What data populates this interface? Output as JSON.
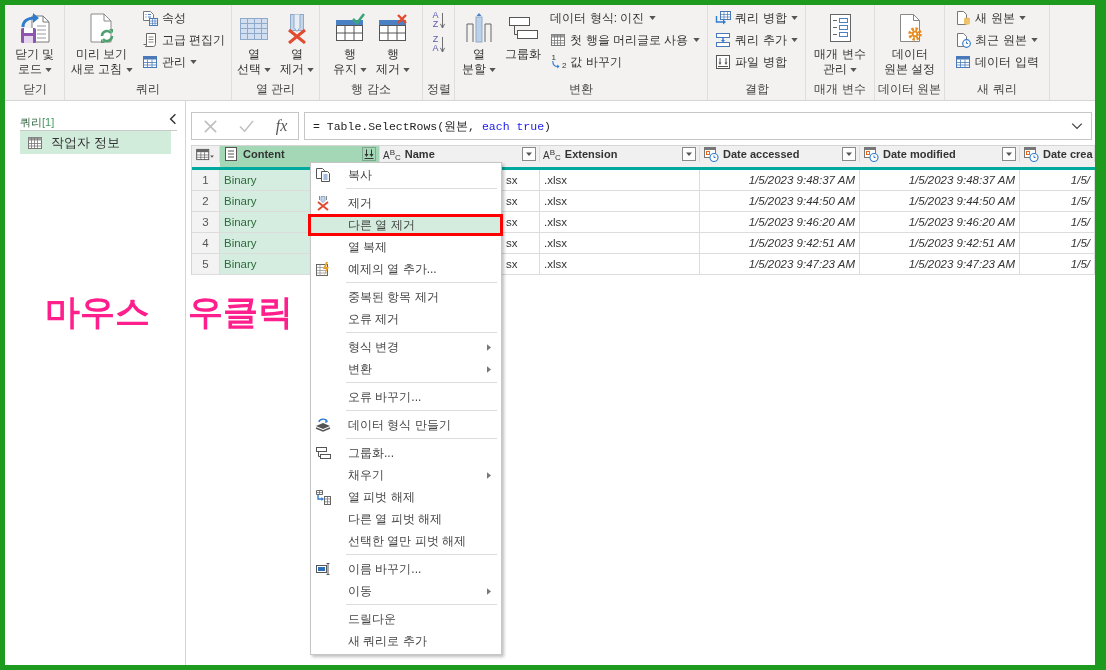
{
  "ribbon": {
    "groups": [
      {
        "label": "닫기",
        "items": [
          {
            "kind": "large",
            "lines": [
              "닫기 및",
              "로드"
            ],
            "dropdown": true
          }
        ]
      },
      {
        "label": "쿼리",
        "items": [
          {
            "kind": "large",
            "lines": [
              "미리 보기",
              "새로 고침"
            ],
            "dropdown": true
          },
          {
            "kind": "small",
            "label": "속성",
            "dropdown": false
          },
          {
            "kind": "small",
            "label": "고급 편집기",
            "dropdown": false
          },
          {
            "kind": "small",
            "label": "관리",
            "dropdown": true
          }
        ]
      },
      {
        "label": "열 관리",
        "items": [
          {
            "kind": "large",
            "lines": [
              "열",
              "선택"
            ],
            "dropdown": true
          },
          {
            "kind": "large",
            "lines": [
              "열",
              "제거"
            ],
            "dropdown": true
          }
        ]
      },
      {
        "label": "행 감소",
        "items": [
          {
            "kind": "large",
            "lines": [
              "행",
              "유지"
            ],
            "dropdown": true
          },
          {
            "kind": "large",
            "lines": [
              "행",
              "제거"
            ],
            "dropdown": true
          }
        ]
      },
      {
        "label": "정렬",
        "items": [
          {
            "kind": "sort",
            "glyphs": [
              "A",
              "Z"
            ]
          },
          {
            "kind": "sort",
            "glyphs": [
              "Z",
              "A"
            ]
          }
        ]
      },
      {
        "label": "변환",
        "items": [
          {
            "kind": "large",
            "lines": [
              "열",
              "분할"
            ],
            "dropdown": true
          },
          {
            "kind": "large",
            "lines": [
              "그룹화"
            ],
            "dropdown": false
          },
          {
            "kind": "small",
            "label": "데이터 형식: 이진",
            "dropdown": true
          },
          {
            "kind": "small",
            "label": "첫 행을 머리글로 사용",
            "dropdown": true
          },
          {
            "kind": "small",
            "label": "값 바꾸기",
            "dropdown": false,
            "glyphs": [
              "1",
              "2"
            ]
          }
        ]
      },
      {
        "label": "결합",
        "items": [
          {
            "kind": "small",
            "label": "쿼리 병합",
            "dropdown": true
          },
          {
            "kind": "small",
            "label": "쿼리 추가",
            "dropdown": true
          },
          {
            "kind": "small",
            "label": "파일 병합",
            "dropdown": false
          }
        ]
      },
      {
        "label": "매개 변수",
        "items": [
          {
            "kind": "large",
            "lines": [
              "매개 변수",
              "관리"
            ],
            "dropdown": true
          }
        ]
      },
      {
        "label": "데이터 원본",
        "items": [
          {
            "kind": "large",
            "lines": [
              "데이터",
              "원본 설정"
            ],
            "dropdown": false
          }
        ]
      },
      {
        "label": "새 쿼리",
        "items": [
          {
            "kind": "small",
            "label": "새 원본",
            "dropdown": true
          },
          {
            "kind": "small",
            "label": "최근 원본",
            "dropdown": true
          },
          {
            "kind": "small",
            "label": "데이터 입력",
            "dropdown": false
          }
        ]
      }
    ]
  },
  "queries_pane": {
    "title": "쿼리",
    "count": "[1]",
    "items": [
      {
        "label": "작업자 정보",
        "selected": true
      }
    ]
  },
  "formula_bar": {
    "function_label": "fx",
    "formula": [
      {
        "kind": "plain",
        "text": "= Table.SelectRows(원본, "
      },
      {
        "kind": "keyword",
        "text": "each true"
      },
      {
        "kind": "plain",
        "text": ")"
      }
    ]
  },
  "table": {
    "columns": [
      {
        "name": "Content",
        "kind": "binary",
        "selected": true
      },
      {
        "name": "Name",
        "kind": "text",
        "type_glyph": "A$^{B}$$_{C}$",
        "selected": false
      },
      {
        "name": "Extension",
        "kind": "text",
        "type_glyph": "A$^{B}$$_{C}$",
        "selected": false
      },
      {
        "name": "Date accessed",
        "kind": "datetime",
        "selected": false
      },
      {
        "name": "Date modified",
        "kind": "datetime",
        "selected": false
      },
      {
        "name": "Date crea",
        "kind": "datetime",
        "selected": false
      }
    ],
    "rows": [
      {
        "number": "1",
        "cells": [
          "Binary",
          "sx",
          ".xlsx",
          "1/5/2023 9:48:37 AM",
          "1/5/2023 9:48:37 AM",
          "1/5/"
        ]
      },
      {
        "number": "2",
        "cells": [
          "Binary",
          "sx",
          ".xlsx",
          "1/5/2023 9:44:50 AM",
          "1/5/2023 9:44:50 AM",
          "1/5/"
        ]
      },
      {
        "number": "3",
        "cells": [
          "Binary",
          "sx",
          ".xlsx",
          "1/5/2023 9:46:20 AM",
          "1/5/2023 9:46:20 AM",
          "1/5/"
        ]
      },
      {
        "number": "4",
        "cells": [
          "Binary",
          "sx",
          ".xlsx",
          "1/5/2023 9:42:51 AM",
          "1/5/2023 9:42:51 AM",
          "1/5/"
        ]
      },
      {
        "number": "5",
        "cells": [
          "Binary",
          "sx",
          ".xlsx",
          "1/5/2023 9:47:23 AM",
          "1/5/2023 9:47:23 AM",
          "1/5/"
        ]
      }
    ]
  },
  "context_menu": {
    "items": [
      {
        "kind": "item",
        "label": "복사",
        "submenu": false,
        "selected": false,
        "outlined": false
      },
      {
        "kind": "separator"
      },
      {
        "kind": "item",
        "label": "제거",
        "submenu": false,
        "selected": false,
        "outlined": false
      },
      {
        "kind": "item",
        "label": "다른 열 제거",
        "submenu": false,
        "selected": true,
        "outlined": true
      },
      {
        "kind": "item",
        "label": "열 복제",
        "submenu": false,
        "selected": false,
        "outlined": false
      },
      {
        "kind": "item",
        "label": "예제의 열 추가...",
        "submenu": false,
        "selected": false,
        "outlined": false
      },
      {
        "kind": "separator"
      },
      {
        "kind": "item",
        "label": "중복된 항목 제거",
        "submenu": false,
        "selected": false,
        "outlined": false
      },
      {
        "kind": "item",
        "label": "오류 제거",
        "submenu": false,
        "selected": false,
        "outlined": false
      },
      {
        "kind": "separator"
      },
      {
        "kind": "item",
        "label": "형식 변경",
        "submenu": true,
        "selected": false,
        "outlined": false
      },
      {
        "kind": "item",
        "label": "변환",
        "submenu": true,
        "selected": false,
        "outlined": false
      },
      {
        "kind": "separator"
      },
      {
        "kind": "item",
        "label": "오류 바꾸기...",
        "submenu": false,
        "selected": false,
        "outlined": false
      },
      {
        "kind": "separator"
      },
      {
        "kind": "item",
        "label": "데이터 형식 만들기",
        "submenu": false,
        "selected": false,
        "outlined": false
      },
      {
        "kind": "separator"
      },
      {
        "kind": "item",
        "label": "그룹화...",
        "submenu": false,
        "selected": false,
        "outlined": false
      },
      {
        "kind": "item",
        "label": "채우기",
        "submenu": true,
        "selected": false,
        "outlined": false
      },
      {
        "kind": "item",
        "label": "열 피벗 해제",
        "submenu": false,
        "selected": false,
        "outlined": false
      },
      {
        "kind": "item",
        "label": "다른 열 피벗 해제",
        "submenu": false,
        "selected": false,
        "outlined": false
      },
      {
        "kind": "item",
        "label": "선택한 열만 피벗 해제",
        "submenu": false,
        "selected": false,
        "outlined": false
      },
      {
        "kind": "separator"
      },
      {
        "kind": "item",
        "label": "이름 바꾸기...",
        "submenu": false,
        "selected": false,
        "outlined": false
      },
      {
        "kind": "item",
        "label": "이동",
        "submenu": true,
        "selected": false,
        "outlined": false
      },
      {
        "kind": "separator"
      },
      {
        "kind": "item",
        "label": "드릴다운",
        "submenu": false,
        "selected": false,
        "outlined": false
      },
      {
        "kind": "item",
        "label": "새 쿼리로 추가",
        "submenu": false,
        "selected": false,
        "outlined": false
      }
    ]
  },
  "annotation": {
    "text": "마우스 우클릭"
  }
}
